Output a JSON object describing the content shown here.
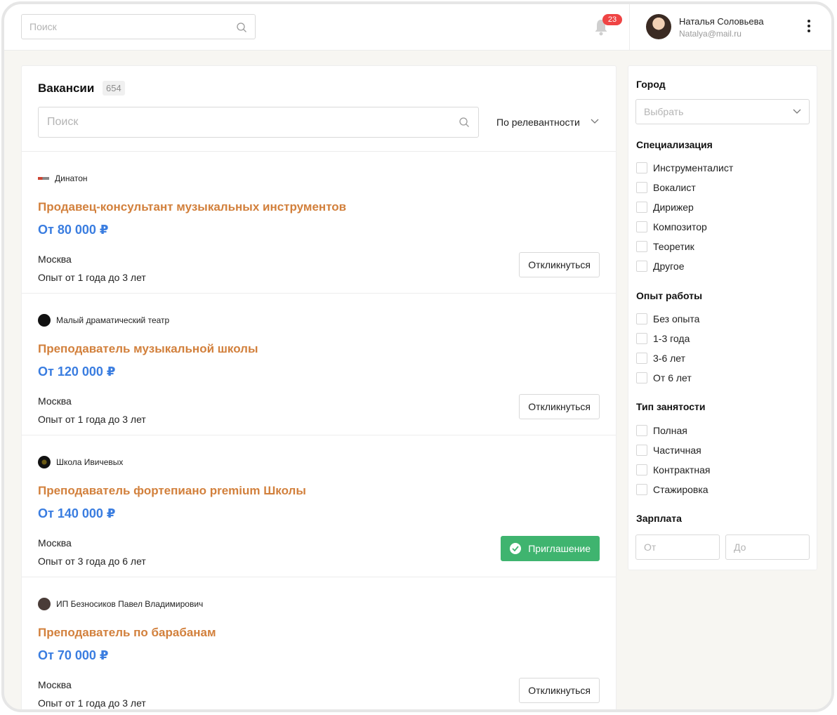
{
  "header": {
    "search_placeholder": "Поиск",
    "notifications_count": "23",
    "user_name": "Наталья Соловьева",
    "user_email": "Natalya@mail.ru"
  },
  "main": {
    "title": "Вакансии",
    "count": "654",
    "search_placeholder": "Поиск",
    "sort_label": "По релевантности"
  },
  "jobs": [
    {
      "company": "Динатон",
      "title": "Продавец-консультант музыкальных инструментов",
      "salary": "От 80 000 ₽",
      "city": "Москва",
      "experience": "Опыт от 1 года до 3 лет",
      "action": "Откликнуться",
      "invited": false
    },
    {
      "company": "Малый драматический театр",
      "title": "Преподаватель музыкальной школы",
      "salary": "От 120 000 ₽",
      "city": "Москва",
      "experience": "Опыт от 1 года до 3 лет",
      "action": "Откликнуться",
      "invited": false
    },
    {
      "company": "Школа Ивичевых",
      "title": "Преподаватель фортепиано premium Школы",
      "salary": "От 140 000 ₽",
      "city": "Москва",
      "experience": "Опыт от 3 года до 6 лет",
      "action": "Приглашение",
      "invited": true
    },
    {
      "company": "ИП Безносиков Павел Владимирович",
      "title": "Преподаватель по барабанам",
      "salary": "От 70 000 ₽",
      "city": "Москва",
      "experience": "Опыт от 1 года до 3 лет",
      "action": "Откликнуться",
      "invited": false
    }
  ],
  "filters": {
    "city_label": "Город",
    "city_placeholder": "Выбрать",
    "specialization_label": "Специализация",
    "specialization": [
      "Инструменталист",
      "Вокалист",
      "Дирижер",
      "Композитор",
      "Теоретик",
      "Другое"
    ],
    "experience_label": "Опыт работы",
    "experience": [
      "Без опыта",
      "1-3 года",
      "3-6 лет",
      "От 6 лет"
    ],
    "employment_label": "Тип занятости",
    "employment": [
      "Полная",
      "Частичная",
      "Контрактная",
      "Стажировка"
    ],
    "salary_label": "Зарплата",
    "salary_from_placeholder": "От",
    "salary_to_placeholder": "До"
  },
  "colors": {
    "job_title": "#d2803c",
    "salary": "#3a7de0",
    "invite": "#3fb46f",
    "badge": "#ef4444"
  }
}
